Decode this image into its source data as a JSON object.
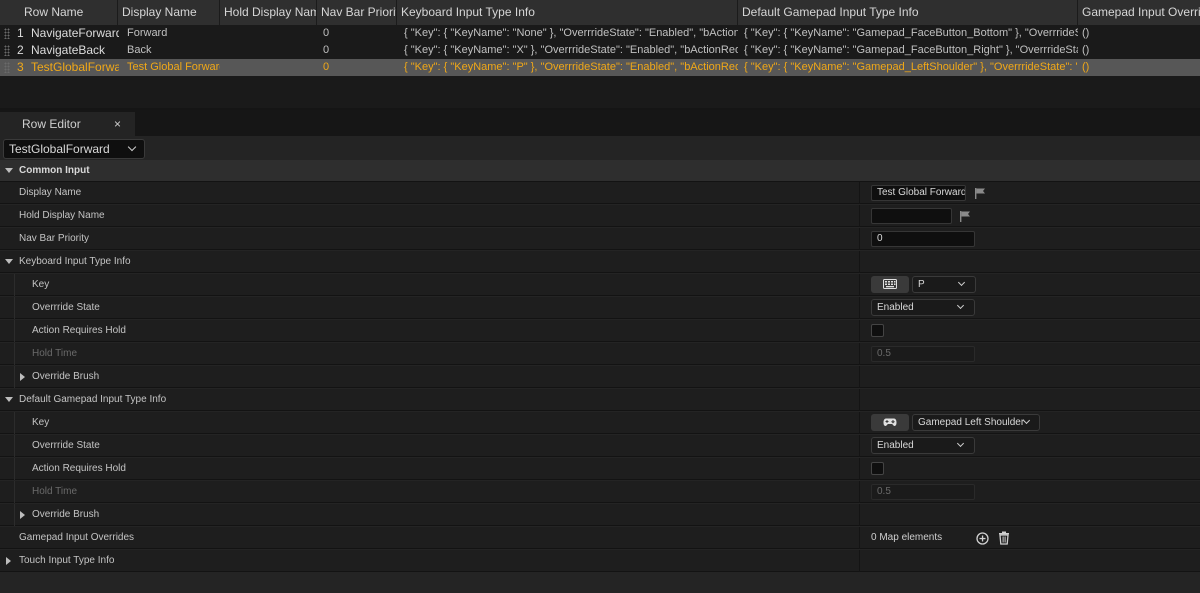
{
  "table": {
    "columns": [
      "Row Name",
      "Display Name",
      "Hold Display Name",
      "Nav Bar Priority",
      "Keyboard Input Type Info",
      "Default Gamepad Input Type Info",
      "Gamepad Input Override"
    ],
    "rows": [
      {
        "index": "1",
        "row_name": "NavigateForward",
        "display_name": "Forward",
        "hold_display_name": "",
        "nav_bar_priority": "0",
        "keyboard": "{ \"Key\": { \"KeyName\": \"None\" }, \"OverrrideState\": \"Enabled\", \"bActionRequiresHold\"",
        "gamepad": "{ \"Key\": { \"KeyName\": \"Gamepad_FaceButton_Bottom\" }, \"OverrrideState\": \"Enabled\"",
        "gamepad_override": "()",
        "selected": false
      },
      {
        "index": "2",
        "row_name": "NavigateBack",
        "display_name": "Back",
        "hold_display_name": "",
        "nav_bar_priority": "0",
        "keyboard": "{ \"Key\": { \"KeyName\": \"X\" }, \"OverrrideState\": \"Enabled\", \"bActionRequiresHold\"",
        "gamepad": "{ \"Key\": { \"KeyName\": \"Gamepad_FaceButton_Right\" }, \"OverrrideState\": \"Enabled\"",
        "gamepad_override": "()",
        "selected": false
      },
      {
        "index": "3",
        "row_name": "TestGlobalForward",
        "display_name": "Test Global Forward",
        "hold_display_name": "",
        "nav_bar_priority": "0",
        "keyboard": "{ \"Key\": { \"KeyName\": \"P\" }, \"OverrrideState\": \"Enabled\", \"bActionRequiresHold\"",
        "gamepad": "{ \"Key\": { \"KeyName\": \"Gamepad_LeftShoulder\" }, \"OverrrideState\": \"Enabled\"",
        "gamepad_override": "()",
        "selected": true
      }
    ]
  },
  "editor": {
    "tab_label": "Row Editor",
    "tab_close": "×",
    "row_selector": "TestGlobalForward",
    "common_input": "Common Input",
    "display_name_label": "Display Name",
    "display_name_value": "Test Global Forward",
    "hold_display_name_label": "Hold Display Name",
    "hold_display_name_value": "",
    "nav_bar_priority_label": "Nav Bar Priority",
    "nav_bar_priority_value": "0",
    "keyboard": {
      "header": "Keyboard Input Type Info",
      "key_label": "Key",
      "key_value": "P",
      "override_label": "Overrride State",
      "override_value": "Enabled",
      "hold_label": "Action Requires Hold",
      "hold_time_label": "Hold Time",
      "hold_time_value": "0.5",
      "brush_label": "Override Brush"
    },
    "gamepad": {
      "header": "Default Gamepad Input Type Info",
      "key_label": "Key",
      "key_value": "Gamepad Left Shoulder",
      "override_label": "Overrride State",
      "override_value": "Enabled",
      "hold_label": "Action Requires Hold",
      "hold_time_label": "Hold Time",
      "hold_time_value": "0.5",
      "brush_label": "Override Brush"
    },
    "overrides_label": "Gamepad Input Overrides",
    "overrides_value": "0 Map elements",
    "touch_label": "Touch Input Type Info"
  },
  "colors": {
    "selected_text": "#f0a818",
    "panel_bg": "#242424",
    "category_bg": "#2e2e2e"
  }
}
